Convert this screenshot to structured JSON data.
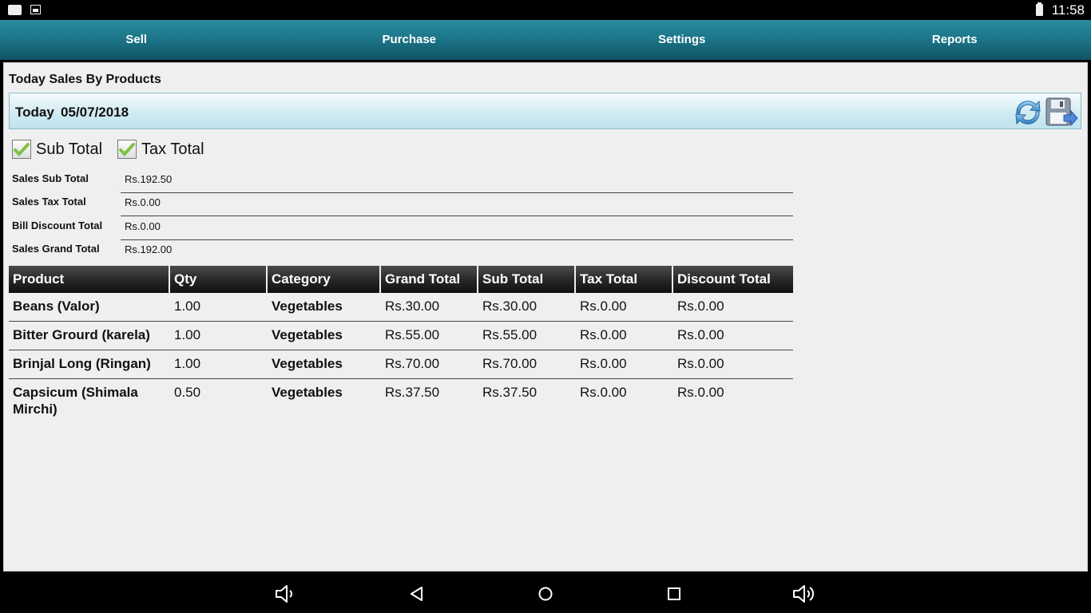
{
  "status": {
    "time": "11:58"
  },
  "nav": {
    "tabs": [
      "Sell",
      "Purchase",
      "Settings",
      "Reports"
    ]
  },
  "page": {
    "title": "Today Sales By Products",
    "date_label": "Today",
    "date": "05/07/2018"
  },
  "checks": {
    "sub_total": {
      "label": "Sub Total",
      "checked": true
    },
    "tax_total": {
      "label": "Tax Total",
      "checked": true
    }
  },
  "summary": [
    {
      "label": "Sales Sub Total",
      "value": "Rs.192.50"
    },
    {
      "label": "Sales Tax Total",
      "value": "Rs.0.00"
    },
    {
      "label": "Bill Discount Total",
      "value": "Rs.0.00"
    },
    {
      "label": "Sales Grand Total",
      "value": "Rs.192.00"
    }
  ],
  "table": {
    "columns": [
      "Product",
      "Qty",
      "Category",
      "Grand Total",
      "Sub Total",
      "Tax Total",
      "Discount Total"
    ],
    "rows": [
      [
        "Beans (Valor)",
        "1.00",
        "Vegetables",
        "Rs.30.00",
        "Rs.30.00",
        "Rs.0.00",
        "Rs.0.00"
      ],
      [
        "Bitter Grourd (karela)",
        "1.00",
        "Vegetables",
        "Rs.55.00",
        "Rs.55.00",
        "Rs.0.00",
        "Rs.0.00"
      ],
      [
        "Brinjal Long (Ringan)",
        "1.00",
        "Vegetables",
        "Rs.70.00",
        "Rs.70.00",
        "Rs.0.00",
        "Rs.0.00"
      ],
      [
        "Capsicum (Shimala Mirchi)",
        "0.50",
        "Vegetables",
        "Rs.37.50",
        "Rs.37.50",
        "Rs.0.00",
        "Rs.0.00"
      ]
    ]
  },
  "colors": {
    "nav": "#1d7689",
    "header": "#232323",
    "accent": "#7ec242"
  }
}
